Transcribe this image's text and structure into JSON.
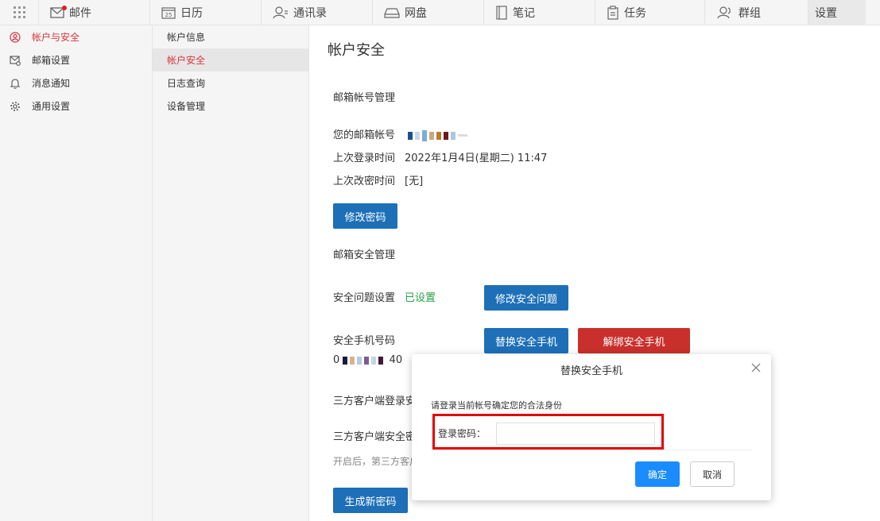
{
  "nav": {
    "items": [
      {
        "label": "邮件",
        "icon": "mail-icon"
      },
      {
        "label": "日历",
        "icon": "calendar-icon",
        "badge_num": "25"
      },
      {
        "label": "通讯录",
        "icon": "contacts-icon"
      },
      {
        "label": "网盘",
        "icon": "drive-icon"
      },
      {
        "label": "笔记",
        "icon": "note-icon"
      },
      {
        "label": "任务",
        "icon": "task-icon"
      },
      {
        "label": "群组",
        "icon": "group-icon"
      },
      {
        "label": "设置"
      }
    ]
  },
  "sidebar": {
    "items": [
      {
        "label": "帐户与安全",
        "icon": "user-circle-icon"
      },
      {
        "label": "邮箱设置",
        "icon": "mail-gear-icon"
      },
      {
        "label": "消息通知",
        "icon": "bell-icon"
      },
      {
        "label": "通用设置",
        "icon": "gear-icon"
      }
    ]
  },
  "subsidebar": {
    "items": [
      "帐户信息",
      "帐户安全",
      "日志查询",
      "设备管理"
    ]
  },
  "main": {
    "title": "帐户安全",
    "email_section": "邮箱帐号管理",
    "account_label": "您的邮箱帐号",
    "last_login_label": "上次登录时间",
    "last_login_value": "2022年1月4日(星期二) 11:47",
    "last_pwd_label": "上次改密时间",
    "last_pwd_value": "[无]",
    "change_pwd_button": "修改密码",
    "security_section": "邮箱安全管理",
    "question_label": "安全问题设置",
    "question_status": "已设置",
    "change_question_button": "修改安全问题",
    "phone_label": "安全手机号码",
    "phone_prefix": "0",
    "phone_suffix": "40",
    "replace_phone_button": "替换安全手机",
    "unbind_phone_button": "解绑安全手机",
    "third_party_login": "三方客户端登录安",
    "third_party_pwd": "三方客户端安全密",
    "third_party_hint": "开启后，第三方客户",
    "generate_pwd_button": "生成新密码"
  },
  "dialog": {
    "title": "替换安全手机",
    "tip": "请登录当前帐号确定您的合法身份",
    "password_label": "登录密码：",
    "password_value": "",
    "ok_button": "确定",
    "cancel_button": "取消"
  },
  "colors": {
    "accent_red": "#d9363e",
    "button_blue": "#1d6fb8",
    "button_red": "#c9302c",
    "ok_blue": "#1a8cff",
    "status_green": "#25a244",
    "highlight_red": "#e60000"
  }
}
